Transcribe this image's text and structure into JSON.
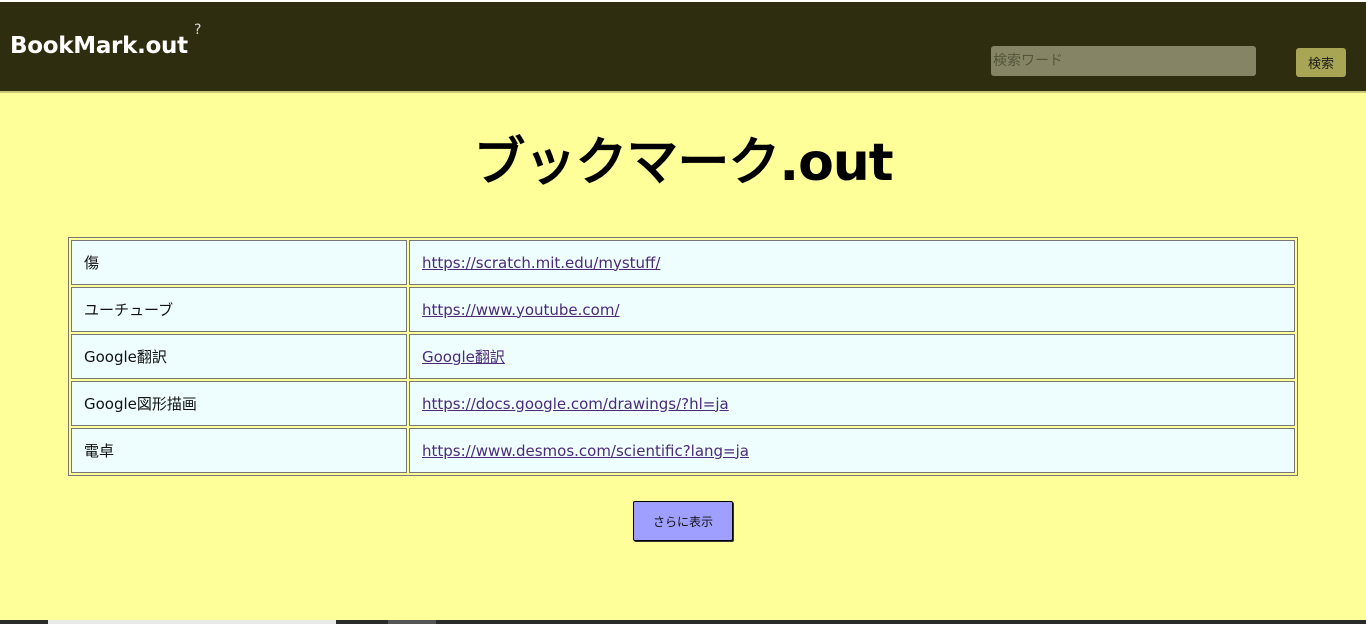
{
  "header": {
    "brand": "BookMark.out",
    "help": "?",
    "search_placeholder": "検索ワード",
    "search_button": "検索"
  },
  "page_title": "ブックマーク.out",
  "bookmarks": [
    {
      "name": "傷",
      "link": "https://scratch.mit.edu/mystuff/"
    },
    {
      "name": "ユーチューブ",
      "link": "https://www.youtube.com/"
    },
    {
      "name": "Google翻訳",
      "link": "Google翻訳"
    },
    {
      "name": "Google図形描画",
      "link": "https://docs.google.com/drawings/?hl=ja"
    },
    {
      "name": "電卓",
      "link": "https://www.desmos.com/scientific?lang=ja"
    }
  ],
  "more_button": "さらに表示",
  "colors": {
    "header_bg": "#2f2d0f",
    "page_bg": "#ffff99",
    "cell_bg": "#eefeff",
    "more_button_bg": "#9f9fff",
    "search_button_bg": "#a8a655"
  }
}
